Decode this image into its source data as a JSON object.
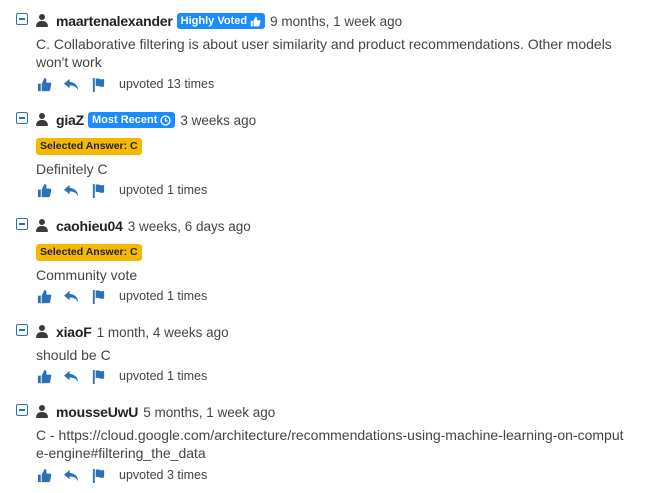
{
  "comments": [
    {
      "username": "maartenalexander",
      "badge": "Highly Voted",
      "time": "9 months, 1 week ago",
      "text": "C. Collaborative filtering is about user similarity and product recommendations. Other models won't work",
      "upvoted": "upvoted 13 times"
    },
    {
      "username": "giaZ",
      "badge": "Most Recent",
      "time": "3 weeks ago",
      "selected": "Selected Answer: C",
      "text": "Definitely C",
      "upvoted": "upvoted 1 times"
    },
    {
      "username": "caohieu04",
      "time": "3 weeks, 6 days ago",
      "selected": "Selected Answer: C",
      "text": "Community vote",
      "upvoted": "upvoted 1 times"
    },
    {
      "username": "xiaoF",
      "time": "1 month, 4 weeks ago",
      "text": "should be C",
      "upvoted": "upvoted 1 times"
    },
    {
      "username": "mousseUwU",
      "time": "5 months, 1 week ago",
      "text": "C - https://cloud.google.com/architecture/recommendations-using-machine-learning-on-compute-engine#filtering_the_data",
      "upvoted": "upvoted 3 times"
    }
  ],
  "colors": {
    "accent": "#2a72b8",
    "badge": "#1a8cff",
    "selected": "#f5b800"
  },
  "icons": [
    "collapse-icon",
    "user-icon",
    "thumbs-up-icon",
    "clock-icon",
    "reply-icon",
    "flag-icon"
  ]
}
